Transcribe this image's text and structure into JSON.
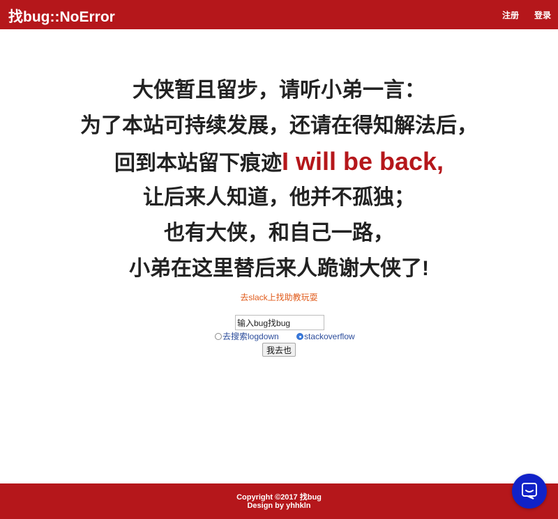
{
  "header": {
    "brand": "找bug::NoError",
    "nav": {
      "register": "注册",
      "login": "登录"
    }
  },
  "message": {
    "lines": [
      "大侠暂且留步，请听小弟一言：",
      "为了本站可持续发展，还请在得知解法后，",
      "回到本站留下痕迹",
      "让后来人知道，他并不孤独；",
      "也有大侠，和自己一路，",
      "小弟在这里替后来人跪谢大侠了!"
    ],
    "highlight": "I will be back,"
  },
  "slack_link": "去slack上找助教玩耍",
  "search": {
    "value": "输入bug找bug",
    "options": [
      {
        "label": "去搜索logdown",
        "checked": false
      },
      {
        "label": "stackoverflow",
        "checked": true
      }
    ],
    "submit_label": "我去也"
  },
  "footer": {
    "copyright": "Copyright ©2017 找bug",
    "design": "Design by yhhkln"
  },
  "colors": {
    "brand_red": "#b5171b",
    "link_orange": "#e05a1a",
    "chat_blue": "#1122c8"
  },
  "icons": {
    "chat_launcher": "chat-bubble-icon"
  }
}
